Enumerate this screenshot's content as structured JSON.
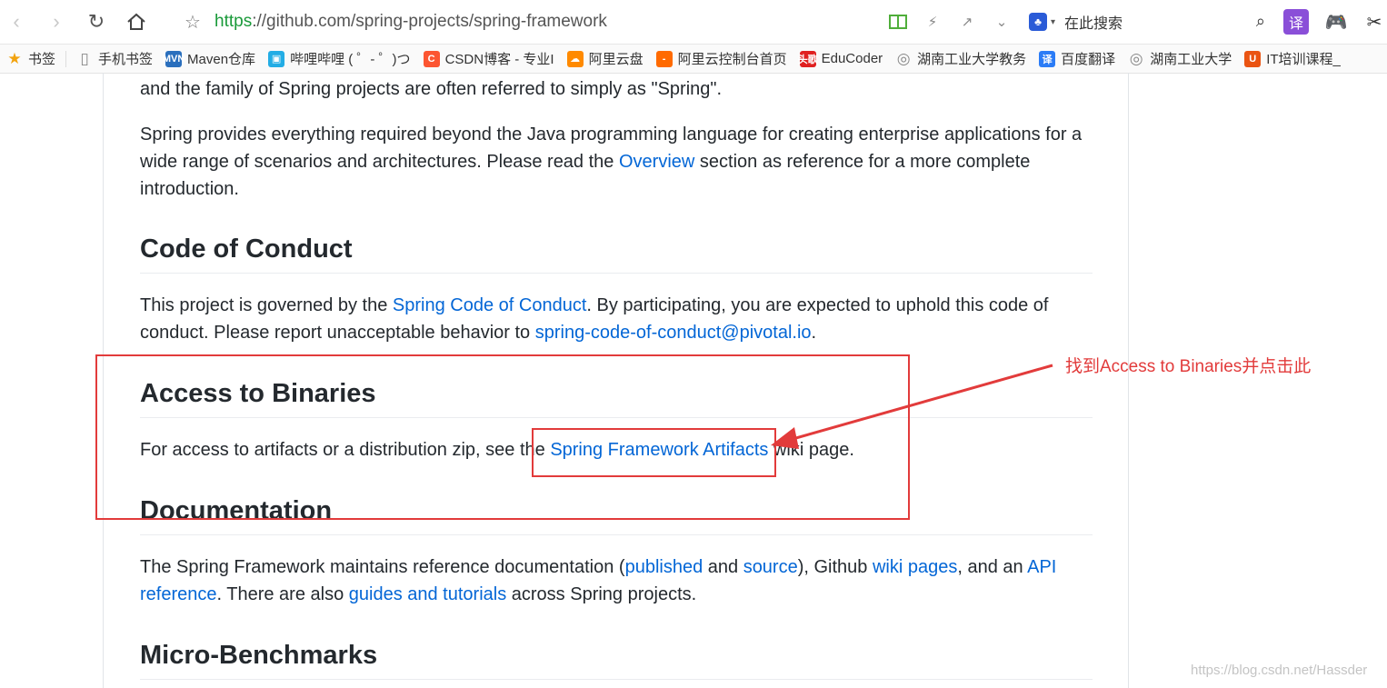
{
  "browser": {
    "url_scheme": "https",
    "url_rest": "://github.com/spring-projects/spring-framework",
    "search_placeholder": "在此搜索",
    "icons": [
      "back-icon",
      "forward-icon",
      "reload-icon",
      "home-icon",
      "star-icon",
      "reading-mode-icon",
      "lightning-icon",
      "share-icon",
      "chevron-down-icon",
      "search-icon",
      "translate-icon",
      "game-icon",
      "scissors-icon"
    ]
  },
  "bookmarks": [
    {
      "label": "书签",
      "icon": "star",
      "color": "#f2a30f"
    },
    {
      "label": "手机书签",
      "icon": "phone",
      "color": "#888888"
    },
    {
      "label": "Maven仓库",
      "icon": "MVN",
      "color": "#2a6fbd"
    },
    {
      "label": "哔哩哔哩 ( ゜- ゜)つ",
      "icon": "tv",
      "color": "#23ade5"
    },
    {
      "label": "CSDN博客 - 专业I",
      "icon": "C",
      "color": "#fc5531"
    },
    {
      "label": "阿里云盘",
      "icon": "cloud",
      "color": "#ff8a00"
    },
    {
      "label": "阿里云控制台首页",
      "icon": "-",
      "color": "#ff6a00"
    },
    {
      "label": "EduCoder",
      "icon": "头歌",
      "color": "#e02020"
    },
    {
      "label": "湖南工业大学教务",
      "icon": "globe",
      "color": "#888888"
    },
    {
      "label": "百度翻译",
      "icon": "译",
      "color": "#2b7cf6"
    },
    {
      "label": "湖南工业大学",
      "icon": "globe",
      "color": "#888888"
    },
    {
      "label": "IT培训课程_",
      "icon": "U",
      "color": "#ea5412"
    }
  ],
  "article": {
    "para0": "and the family of Spring projects are often referred to simply as \"Spring\".",
    "para1_a": "Spring provides everything required beyond the Java programming language for creating enterprise applications for a wide range of scenarios and architectures. Please read the ",
    "para1_link": "Overview",
    "para1_b": " section as reference for a more complete introduction.",
    "h_conduct": "Code of Conduct",
    "conduct_a": "This project is governed by the ",
    "conduct_link1": "Spring Code of Conduct",
    "conduct_b": ". By participating, you are expected to uphold this code of conduct. Please report unacceptable behavior to ",
    "conduct_link2": "spring-code-of-conduct@pivotal.io",
    "conduct_c": ".",
    "h_binaries": "Access to Binaries",
    "bin_a": "For access to artifacts or a distribution zip, see the ",
    "bin_link": "Spring Framework Artifacts",
    "bin_b": " wiki page.",
    "h_docs": "Documentation",
    "docs_a": "The Spring Framework maintains reference documentation (",
    "docs_link1": "published",
    "docs_b": " and ",
    "docs_link2": "source",
    "docs_c": "), Github ",
    "docs_link3": "wiki pages",
    "docs_d": ", and an ",
    "docs_link4": "API reference",
    "docs_e": ". There are also ",
    "docs_link5": "guides and tutorials",
    "docs_f": " across Spring projects.",
    "h_bench": "Micro-Benchmarks"
  },
  "annotation": {
    "label": "找到Access to Binaries并点击此",
    "color": "#e23b3b"
  },
  "watermark": "https://blog.csdn.net/Hassder"
}
